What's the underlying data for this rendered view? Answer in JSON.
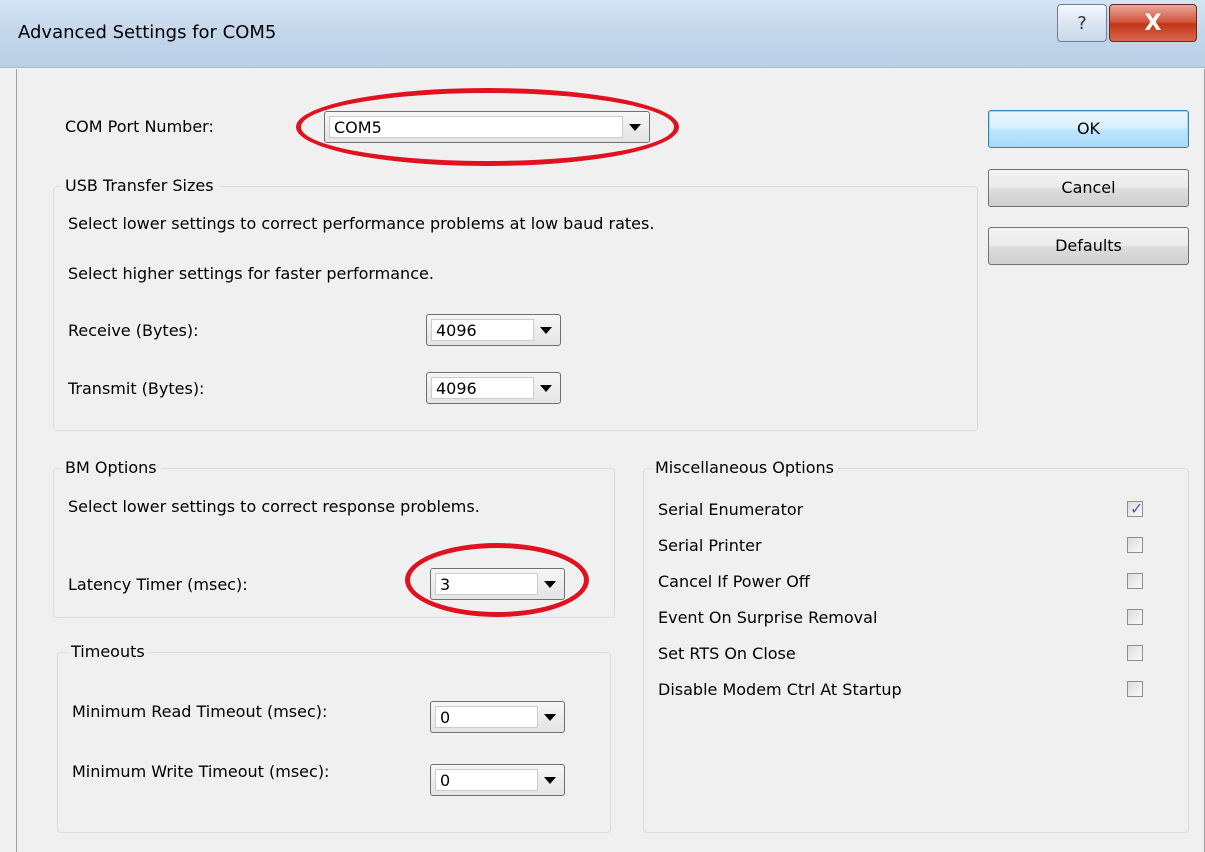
{
  "window": {
    "title": "Advanced Settings for COM5",
    "help_glyph": "?",
    "close_glyph": "X"
  },
  "com_port": {
    "label": "COM Port Number:",
    "value": "COM5"
  },
  "buttons": {
    "ok": "OK",
    "cancel": "Cancel",
    "defaults": "Defaults"
  },
  "usb_transfer": {
    "caption": "USB Transfer Sizes",
    "line1": "Select lower settings to correct performance problems at low baud rates.",
    "line2": "Select higher settings for faster performance.",
    "receive_label": "Receive (Bytes):",
    "receive_value": "4096",
    "transmit_label": "Transmit (Bytes):",
    "transmit_value": "4096"
  },
  "bm_options": {
    "caption": "BM Options",
    "line1": "Select lower settings to correct response problems.",
    "latency_label": "Latency Timer (msec):",
    "latency_value": "3"
  },
  "timeouts": {
    "caption": "Timeouts",
    "read_label": "Minimum Read Timeout (msec):",
    "read_value": "0",
    "write_label": "Minimum Write Timeout (msec):",
    "write_value": "0"
  },
  "misc": {
    "caption": "Miscellaneous Options",
    "items": [
      {
        "label": "Serial Enumerator",
        "checked": true
      },
      {
        "label": "Serial Printer",
        "checked": false
      },
      {
        "label": "Cancel If Power Off",
        "checked": false
      },
      {
        "label": "Event On Surprise Removal",
        "checked": false
      },
      {
        "label": "Set RTS On Close",
        "checked": false
      },
      {
        "label": "Disable Modem Ctrl At Startup",
        "checked": false
      }
    ]
  },
  "colors": {
    "annotation_ellipse": "#e0121f",
    "checkmark": "#4a5fa8"
  }
}
